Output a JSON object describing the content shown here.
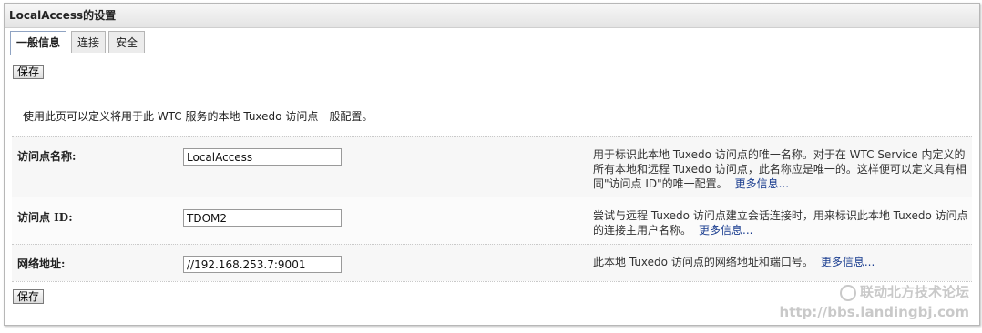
{
  "panel": {
    "title": "LocalAccess的设置"
  },
  "tabs": [
    {
      "label": "一般信息",
      "active": true
    },
    {
      "label": "连接",
      "active": false
    },
    {
      "label": "安全",
      "active": false
    }
  ],
  "toolbar": {
    "save_label": "保存"
  },
  "description": "使用此页可以定义将用于此 WTC 服务的本地 Tuxedo 访问点一般配置。",
  "fields": [
    {
      "label": "访问点名称:",
      "value": "LocalAccess",
      "help": "用于标识此本地 Tuxedo 访问点的唯一名称。对于在 WTC Service 内定义的所有本地和远程 Tuxedo 访问点，此名称应是唯一的。这样便可以定义具有相同\"访问点 ID\"的唯一配置。",
      "more": "更多信息..."
    },
    {
      "label": "访问点 ID:",
      "value": "TDOM2",
      "help": "尝试与远程 Tuxedo 访问点建立会话连接时，用来标识此本地 Tuxedo 访问点的连接主用户名称。",
      "more": "更多信息..."
    },
    {
      "label": "网络地址:",
      "value": "//192.168.253.7:9001",
      "help": "此本地 Tuxedo 访问点的网络地址和端口号。",
      "more": "更多信息..."
    }
  ],
  "watermark": {
    "line1": "联动北方技术论坛",
    "line2": "http://bbs.landingbj.com"
  }
}
